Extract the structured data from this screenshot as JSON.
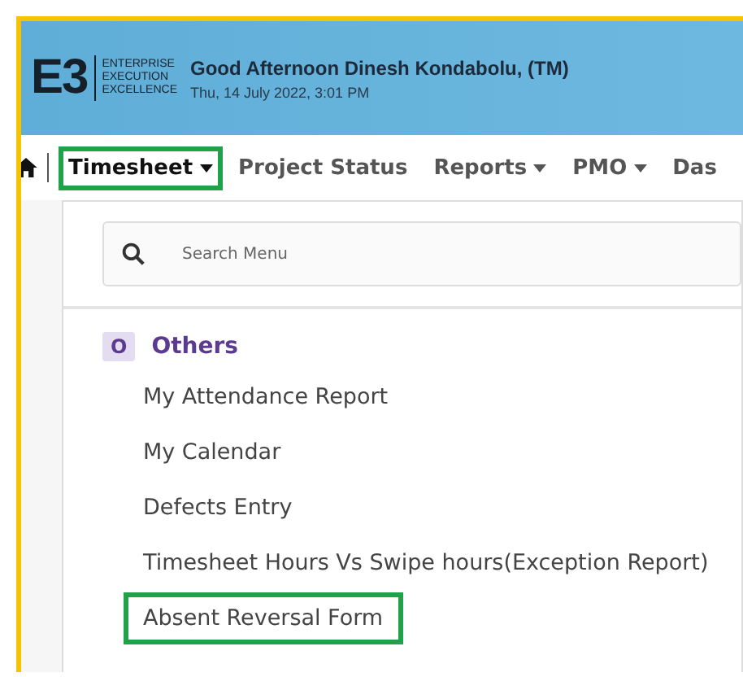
{
  "header": {
    "logo_mark": "E3",
    "logo_lines": [
      "ENTERPRISE",
      "EXECUTION",
      "EXCELLENCE"
    ],
    "greeting": "Good Afternoon Dinesh Kondabolu,  (TM)",
    "date": "Thu, 14 July 2022, 3:01 PM"
  },
  "nav": [
    {
      "label": "Timesheet",
      "caret": true,
      "highlighted": true
    },
    {
      "label": "Project Status",
      "caret": false,
      "highlighted": false
    },
    {
      "label": "Reports",
      "caret": true,
      "highlighted": false
    },
    {
      "label": "PMO",
      "caret": true,
      "highlighted": false
    },
    {
      "label": "Das",
      "caret": false,
      "highlighted": false
    }
  ],
  "search": {
    "placeholder": "Search Menu"
  },
  "section": {
    "badge": "O",
    "title": "Others"
  },
  "menu_items": [
    {
      "label": "My Attendance Report",
      "highlighted": false
    },
    {
      "label": "My Calendar",
      "highlighted": false
    },
    {
      "label": "Defects Entry",
      "highlighted": false
    },
    {
      "label": "Timesheet Hours Vs Swipe hours(Exception Report)",
      "highlighted": false
    },
    {
      "label": "Absent Reversal Form",
      "highlighted": true
    }
  ]
}
